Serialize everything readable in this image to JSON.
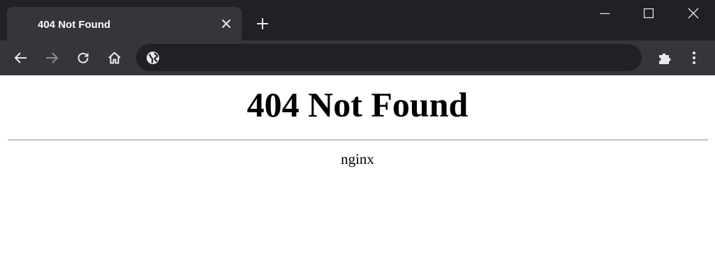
{
  "browser": {
    "tab": {
      "title": "404 Not Found"
    },
    "toolbar": {
      "omnibox_value": "",
      "icons": [
        "back-arrow-icon",
        "forward-arrow-icon",
        "reload-icon",
        "home-icon",
        "globe-icon",
        "extensions-puzzle-icon",
        "kebab-menu-icon"
      ]
    },
    "window_controls": [
      "minimize-icon",
      "maximize-icon",
      "close-icon"
    ],
    "colors": {
      "tab_strip": "#202124",
      "active_tab": "#35363a",
      "toolbar": "#35363a",
      "omnibox": "#202124",
      "icon": "#e8eaed",
      "icon_disabled": "#8a8c90"
    }
  },
  "page": {
    "heading": "404 Not Found",
    "server": "nginx"
  }
}
